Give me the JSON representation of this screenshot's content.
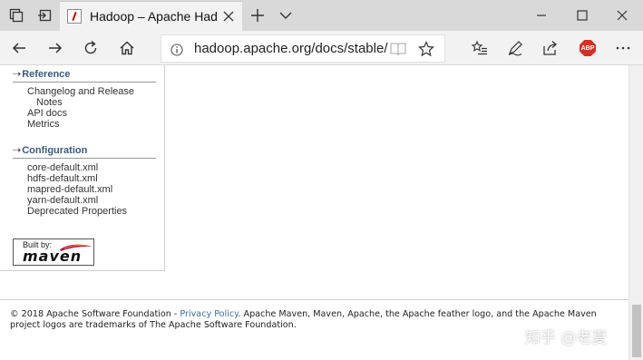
{
  "browser": {
    "tab": {
      "title": "Hadoop – Apache Hadoop"
    },
    "address_bar": {
      "url": "hadoop.apache.org/docs/stable/"
    },
    "extensions": {
      "abp_label": "ABP"
    }
  },
  "sidebar": {
    "sections": [
      {
        "title": "Reference",
        "items": [
          "Changelog and Release",
          "Notes",
          "API docs",
          "Metrics"
        ]
      },
      {
        "title": "Configuration",
        "items": [
          "core-default.xml",
          "hdfs-default.xml",
          "mapred-default.xml",
          "yarn-default.xml",
          "Deprecated Properties"
        ]
      }
    ],
    "built_by": {
      "label": "Built by:",
      "brand": "maven"
    }
  },
  "footer": {
    "prefix": "© 2018 Apache Software Foundation - ",
    "privacy_link": "Privacy Policy",
    "suffix": ". Apache Maven, Maven, Apache, the Apache feather logo, and the Apache Maven project logos are trademarks of The Apache Software Foundation."
  },
  "watermark": {
    "text": "知乎 @老夏"
  }
}
